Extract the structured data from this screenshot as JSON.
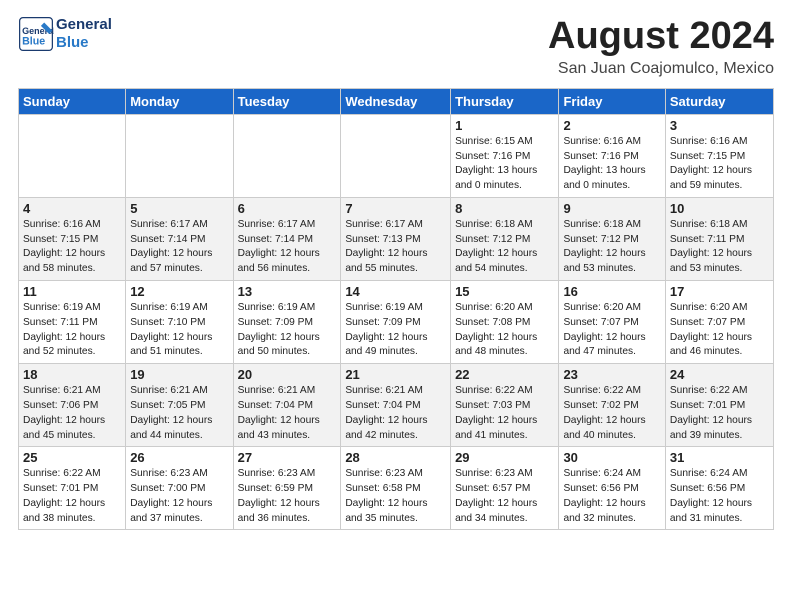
{
  "header": {
    "logo_general": "General",
    "logo_blue": "Blue",
    "month": "August 2024",
    "location": "San Juan Coajomulco, Mexico"
  },
  "weekdays": [
    "Sunday",
    "Monday",
    "Tuesday",
    "Wednesday",
    "Thursday",
    "Friday",
    "Saturday"
  ],
  "weeks": [
    [
      {
        "day": "",
        "info": ""
      },
      {
        "day": "",
        "info": ""
      },
      {
        "day": "",
        "info": ""
      },
      {
        "day": "",
        "info": ""
      },
      {
        "day": "1",
        "info": "Sunrise: 6:15 AM\nSunset: 7:16 PM\nDaylight: 13 hours\nand 0 minutes."
      },
      {
        "day": "2",
        "info": "Sunrise: 6:16 AM\nSunset: 7:16 PM\nDaylight: 13 hours\nand 0 minutes."
      },
      {
        "day": "3",
        "info": "Sunrise: 6:16 AM\nSunset: 7:15 PM\nDaylight: 12 hours\nand 59 minutes."
      }
    ],
    [
      {
        "day": "4",
        "info": "Sunrise: 6:16 AM\nSunset: 7:15 PM\nDaylight: 12 hours\nand 58 minutes."
      },
      {
        "day": "5",
        "info": "Sunrise: 6:17 AM\nSunset: 7:14 PM\nDaylight: 12 hours\nand 57 minutes."
      },
      {
        "day": "6",
        "info": "Sunrise: 6:17 AM\nSunset: 7:14 PM\nDaylight: 12 hours\nand 56 minutes."
      },
      {
        "day": "7",
        "info": "Sunrise: 6:17 AM\nSunset: 7:13 PM\nDaylight: 12 hours\nand 55 minutes."
      },
      {
        "day": "8",
        "info": "Sunrise: 6:18 AM\nSunset: 7:12 PM\nDaylight: 12 hours\nand 54 minutes."
      },
      {
        "day": "9",
        "info": "Sunrise: 6:18 AM\nSunset: 7:12 PM\nDaylight: 12 hours\nand 53 minutes."
      },
      {
        "day": "10",
        "info": "Sunrise: 6:18 AM\nSunset: 7:11 PM\nDaylight: 12 hours\nand 53 minutes."
      }
    ],
    [
      {
        "day": "11",
        "info": "Sunrise: 6:19 AM\nSunset: 7:11 PM\nDaylight: 12 hours\nand 52 minutes."
      },
      {
        "day": "12",
        "info": "Sunrise: 6:19 AM\nSunset: 7:10 PM\nDaylight: 12 hours\nand 51 minutes."
      },
      {
        "day": "13",
        "info": "Sunrise: 6:19 AM\nSunset: 7:09 PM\nDaylight: 12 hours\nand 50 minutes."
      },
      {
        "day": "14",
        "info": "Sunrise: 6:19 AM\nSunset: 7:09 PM\nDaylight: 12 hours\nand 49 minutes."
      },
      {
        "day": "15",
        "info": "Sunrise: 6:20 AM\nSunset: 7:08 PM\nDaylight: 12 hours\nand 48 minutes."
      },
      {
        "day": "16",
        "info": "Sunrise: 6:20 AM\nSunset: 7:07 PM\nDaylight: 12 hours\nand 47 minutes."
      },
      {
        "day": "17",
        "info": "Sunrise: 6:20 AM\nSunset: 7:07 PM\nDaylight: 12 hours\nand 46 minutes."
      }
    ],
    [
      {
        "day": "18",
        "info": "Sunrise: 6:21 AM\nSunset: 7:06 PM\nDaylight: 12 hours\nand 45 minutes."
      },
      {
        "day": "19",
        "info": "Sunrise: 6:21 AM\nSunset: 7:05 PM\nDaylight: 12 hours\nand 44 minutes."
      },
      {
        "day": "20",
        "info": "Sunrise: 6:21 AM\nSunset: 7:04 PM\nDaylight: 12 hours\nand 43 minutes."
      },
      {
        "day": "21",
        "info": "Sunrise: 6:21 AM\nSunset: 7:04 PM\nDaylight: 12 hours\nand 42 minutes."
      },
      {
        "day": "22",
        "info": "Sunrise: 6:22 AM\nSunset: 7:03 PM\nDaylight: 12 hours\nand 41 minutes."
      },
      {
        "day": "23",
        "info": "Sunrise: 6:22 AM\nSunset: 7:02 PM\nDaylight: 12 hours\nand 40 minutes."
      },
      {
        "day": "24",
        "info": "Sunrise: 6:22 AM\nSunset: 7:01 PM\nDaylight: 12 hours\nand 39 minutes."
      }
    ],
    [
      {
        "day": "25",
        "info": "Sunrise: 6:22 AM\nSunset: 7:01 PM\nDaylight: 12 hours\nand 38 minutes."
      },
      {
        "day": "26",
        "info": "Sunrise: 6:23 AM\nSunset: 7:00 PM\nDaylight: 12 hours\nand 37 minutes."
      },
      {
        "day": "27",
        "info": "Sunrise: 6:23 AM\nSunset: 6:59 PM\nDaylight: 12 hours\nand 36 minutes."
      },
      {
        "day": "28",
        "info": "Sunrise: 6:23 AM\nSunset: 6:58 PM\nDaylight: 12 hours\nand 35 minutes."
      },
      {
        "day": "29",
        "info": "Sunrise: 6:23 AM\nSunset: 6:57 PM\nDaylight: 12 hours\nand 34 minutes."
      },
      {
        "day": "30",
        "info": "Sunrise: 6:24 AM\nSunset: 6:56 PM\nDaylight: 12 hours\nand 32 minutes."
      },
      {
        "day": "31",
        "info": "Sunrise: 6:24 AM\nSunset: 6:56 PM\nDaylight: 12 hours\nand 31 minutes."
      }
    ]
  ]
}
